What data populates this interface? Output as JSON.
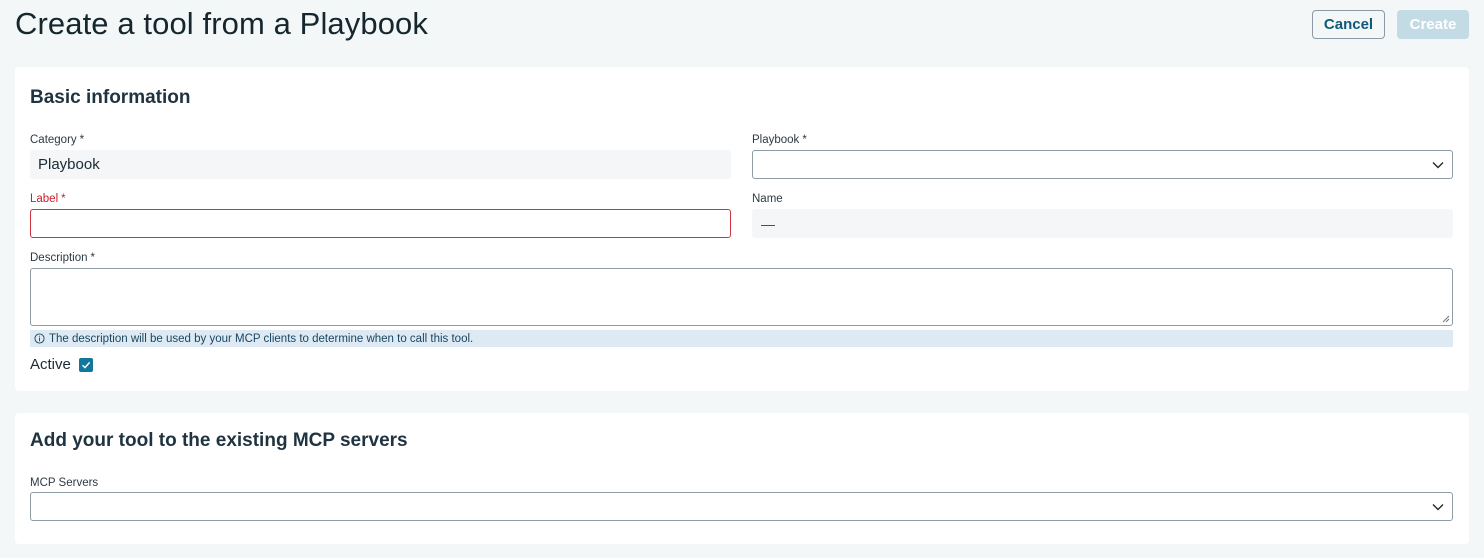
{
  "header": {
    "title": "Create a tool from a Playbook",
    "cancel_label": "Cancel",
    "create_label": "Create"
  },
  "basic": {
    "section_title": "Basic information",
    "category": {
      "label": "Category",
      "required": "*",
      "value": "Playbook"
    },
    "playbook": {
      "label": "Playbook",
      "required": "*",
      "value": ""
    },
    "label_field": {
      "label": "Label",
      "required": "*",
      "value": ""
    },
    "name": {
      "label": "Name",
      "value": "—"
    },
    "description": {
      "label": "Description",
      "required": "*",
      "value": "",
      "help": "The description will be used by your MCP clients to determine when to call this tool."
    },
    "active": {
      "label": "Active",
      "checked": true
    }
  },
  "mcp": {
    "section_title": "Add your tool to the existing MCP servers",
    "servers": {
      "label": "MCP Servers",
      "value": ""
    }
  },
  "colors": {
    "accent": "#13779c",
    "error": "#c8202d",
    "info_bg": "#ddeaf3",
    "disabled_button": "#c2dbe5"
  }
}
